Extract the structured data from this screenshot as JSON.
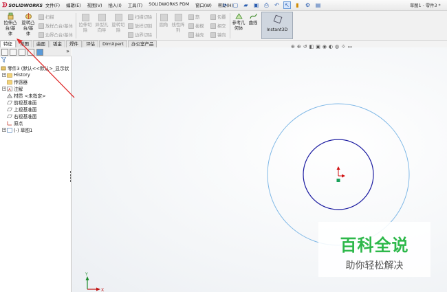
{
  "app": {
    "logo_text": "SOLIDWORKS",
    "menus": [
      "文件(F)",
      "编辑(E)",
      "视图(V)",
      "插入(I)",
      "工具(T)",
      "SOLIDWORKS PDM",
      "窗口(W)",
      "帮助(H)"
    ],
    "title": "草图1 - 零件3 *"
  },
  "ribbon": {
    "extrude_boss": [
      "拉伸凸",
      "台/基",
      "体"
    ],
    "revolve_boss": [
      "旋转凸",
      "台/基",
      "体"
    ],
    "sweep": "扫描",
    "loft_boss": "放样凸台/基体",
    "boundary_boss": "边界凸台/基体",
    "extrude_cut": [
      "拉伸切",
      "除"
    ],
    "hole_wizard": [
      "异型孔",
      "向导"
    ],
    "revolve_cut": [
      "旋转切",
      "除"
    ],
    "swept_cut": "扫描切除",
    "lofted_cut": "放样切割",
    "boundary_cut": "边界切除",
    "fillet": "圆角",
    "linear_pattern": [
      "线性阵",
      "列"
    ],
    "rib": "筋",
    "draft": "拔模",
    "shell": "抽壳",
    "wrap": "包覆",
    "intersect": "相交",
    "mirror": "镜向",
    "ref_geometry": [
      "参考几",
      "何体"
    ],
    "curves": "曲线",
    "instant3d": "Instant3D"
  },
  "tabs": [
    "特征",
    "草图",
    "曲面",
    "钣金",
    "焊件",
    "评估",
    "DimXpert",
    "办公室产品"
  ],
  "tree": [
    {
      "label": "零件3 (默认<<默认>_显示状",
      "level": 0
    },
    {
      "label": "History",
      "level": 1
    },
    {
      "label": "传感器",
      "level": 1
    },
    {
      "label": "注解",
      "level": 1
    },
    {
      "label": "材质 <未指定>",
      "level": 1
    },
    {
      "label": "前视基准面",
      "level": 1
    },
    {
      "label": "上视基准面",
      "level": 1
    },
    {
      "label": "右视基准面",
      "level": 1
    },
    {
      "label": "原点",
      "level": 1
    },
    {
      "label": "(-) 草图1",
      "level": 1
    }
  ],
  "colors": {
    "outer_circle": "#7fb8e6",
    "inner_circle": "#1a1aa0",
    "origin_red": "#d01010",
    "annotation_arrow": "#e03030",
    "watermark_green": "#2db84a"
  },
  "watermark": {
    "main": "百科全说",
    "sub": "助你轻松解决"
  },
  "coordinate_triad": {
    "y_label": "Y",
    "x_label": "X"
  }
}
